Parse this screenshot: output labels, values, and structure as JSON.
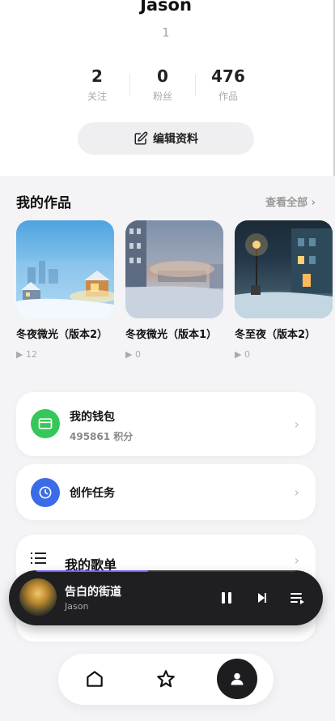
{
  "profile": {
    "name": "Jason",
    "id": "1",
    "stats": [
      {
        "value": "2",
        "label": "关注"
      },
      {
        "value": "0",
        "label": "粉丝"
      },
      {
        "value": "476",
        "label": "作品"
      }
    ],
    "edit_label": "编辑资料"
  },
  "works": {
    "title": "我的作品",
    "see_all": "查看全部 ›",
    "items": [
      {
        "title": "冬夜微光（版本2）",
        "plays": "▶ 12"
      },
      {
        "title": "冬夜微光（版本1）",
        "plays": "▶ 0"
      },
      {
        "title": "冬至夜（版本2）",
        "plays": "▶ 0"
      }
    ]
  },
  "wallet": {
    "title": "我的钱包",
    "points": "495861 积分"
  },
  "tasks": {
    "title": "创作任务"
  },
  "playlist": {
    "title": "我的歌单"
  },
  "player": {
    "title": "告白的街道",
    "artist": "Jason",
    "progress": 0.43
  },
  "colors": {
    "wallet_green": "#34c759",
    "task_blue": "#3a6be8",
    "accent_purple": "#7a5cff"
  }
}
